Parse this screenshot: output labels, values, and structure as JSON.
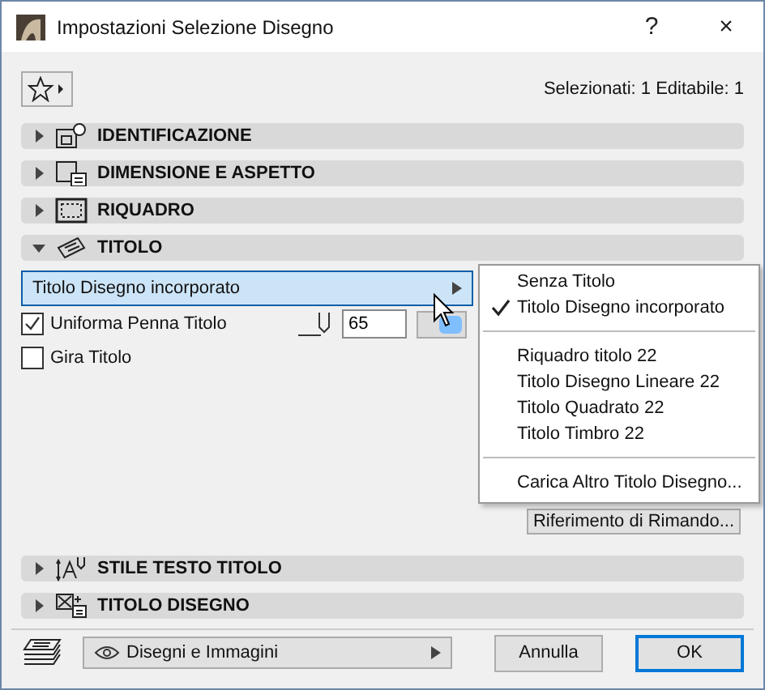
{
  "window": {
    "title": "Impostazioni Selezione Disegno",
    "help": "?",
    "close": "×"
  },
  "selection_info": "Selezionati: 1 Editabile: 1",
  "sections_top": [
    {
      "label": "IDENTIFICAZIONE",
      "expanded": false
    },
    {
      "label": "DIMENSIONE E ASPETTO",
      "expanded": false
    },
    {
      "label": "RIQUADRO",
      "expanded": false
    },
    {
      "label": "TITOLO",
      "expanded": true
    }
  ],
  "title_panel": {
    "dropdown": "Titolo Disegno incorporato",
    "options": [
      {
        "label": "Uniforma Penna Titolo",
        "checked": true
      },
      {
        "label": "Gira Titolo",
        "checked": false
      }
    ],
    "pen_value": "65",
    "cross_ref_button": "Riferimento di Rimando..."
  },
  "menu": {
    "groups": [
      [
        {
          "label": "Senza Titolo",
          "selected": false
        },
        {
          "label": "Titolo Disegno incorporato",
          "selected": true
        }
      ],
      [
        {
          "label": "Riquadro titolo 22",
          "selected": false
        },
        {
          "label": "Titolo Disegno Lineare 22",
          "selected": false
        },
        {
          "label": "Titolo Quadrato 22",
          "selected": false
        },
        {
          "label": "Titolo Timbro 22",
          "selected": false
        }
      ],
      [
        {
          "label": "Carica Altro Titolo Disegno...",
          "selected": false
        }
      ]
    ]
  },
  "sections_bottom": [
    {
      "label": "STILE TESTO TITOLO",
      "expanded": false
    },
    {
      "label": "TITOLO DISEGNO",
      "expanded": false
    }
  ],
  "footer": {
    "layer_dropdown": "Disegni e Immagini",
    "cancel": "Annulla",
    "ok": "OK"
  }
}
